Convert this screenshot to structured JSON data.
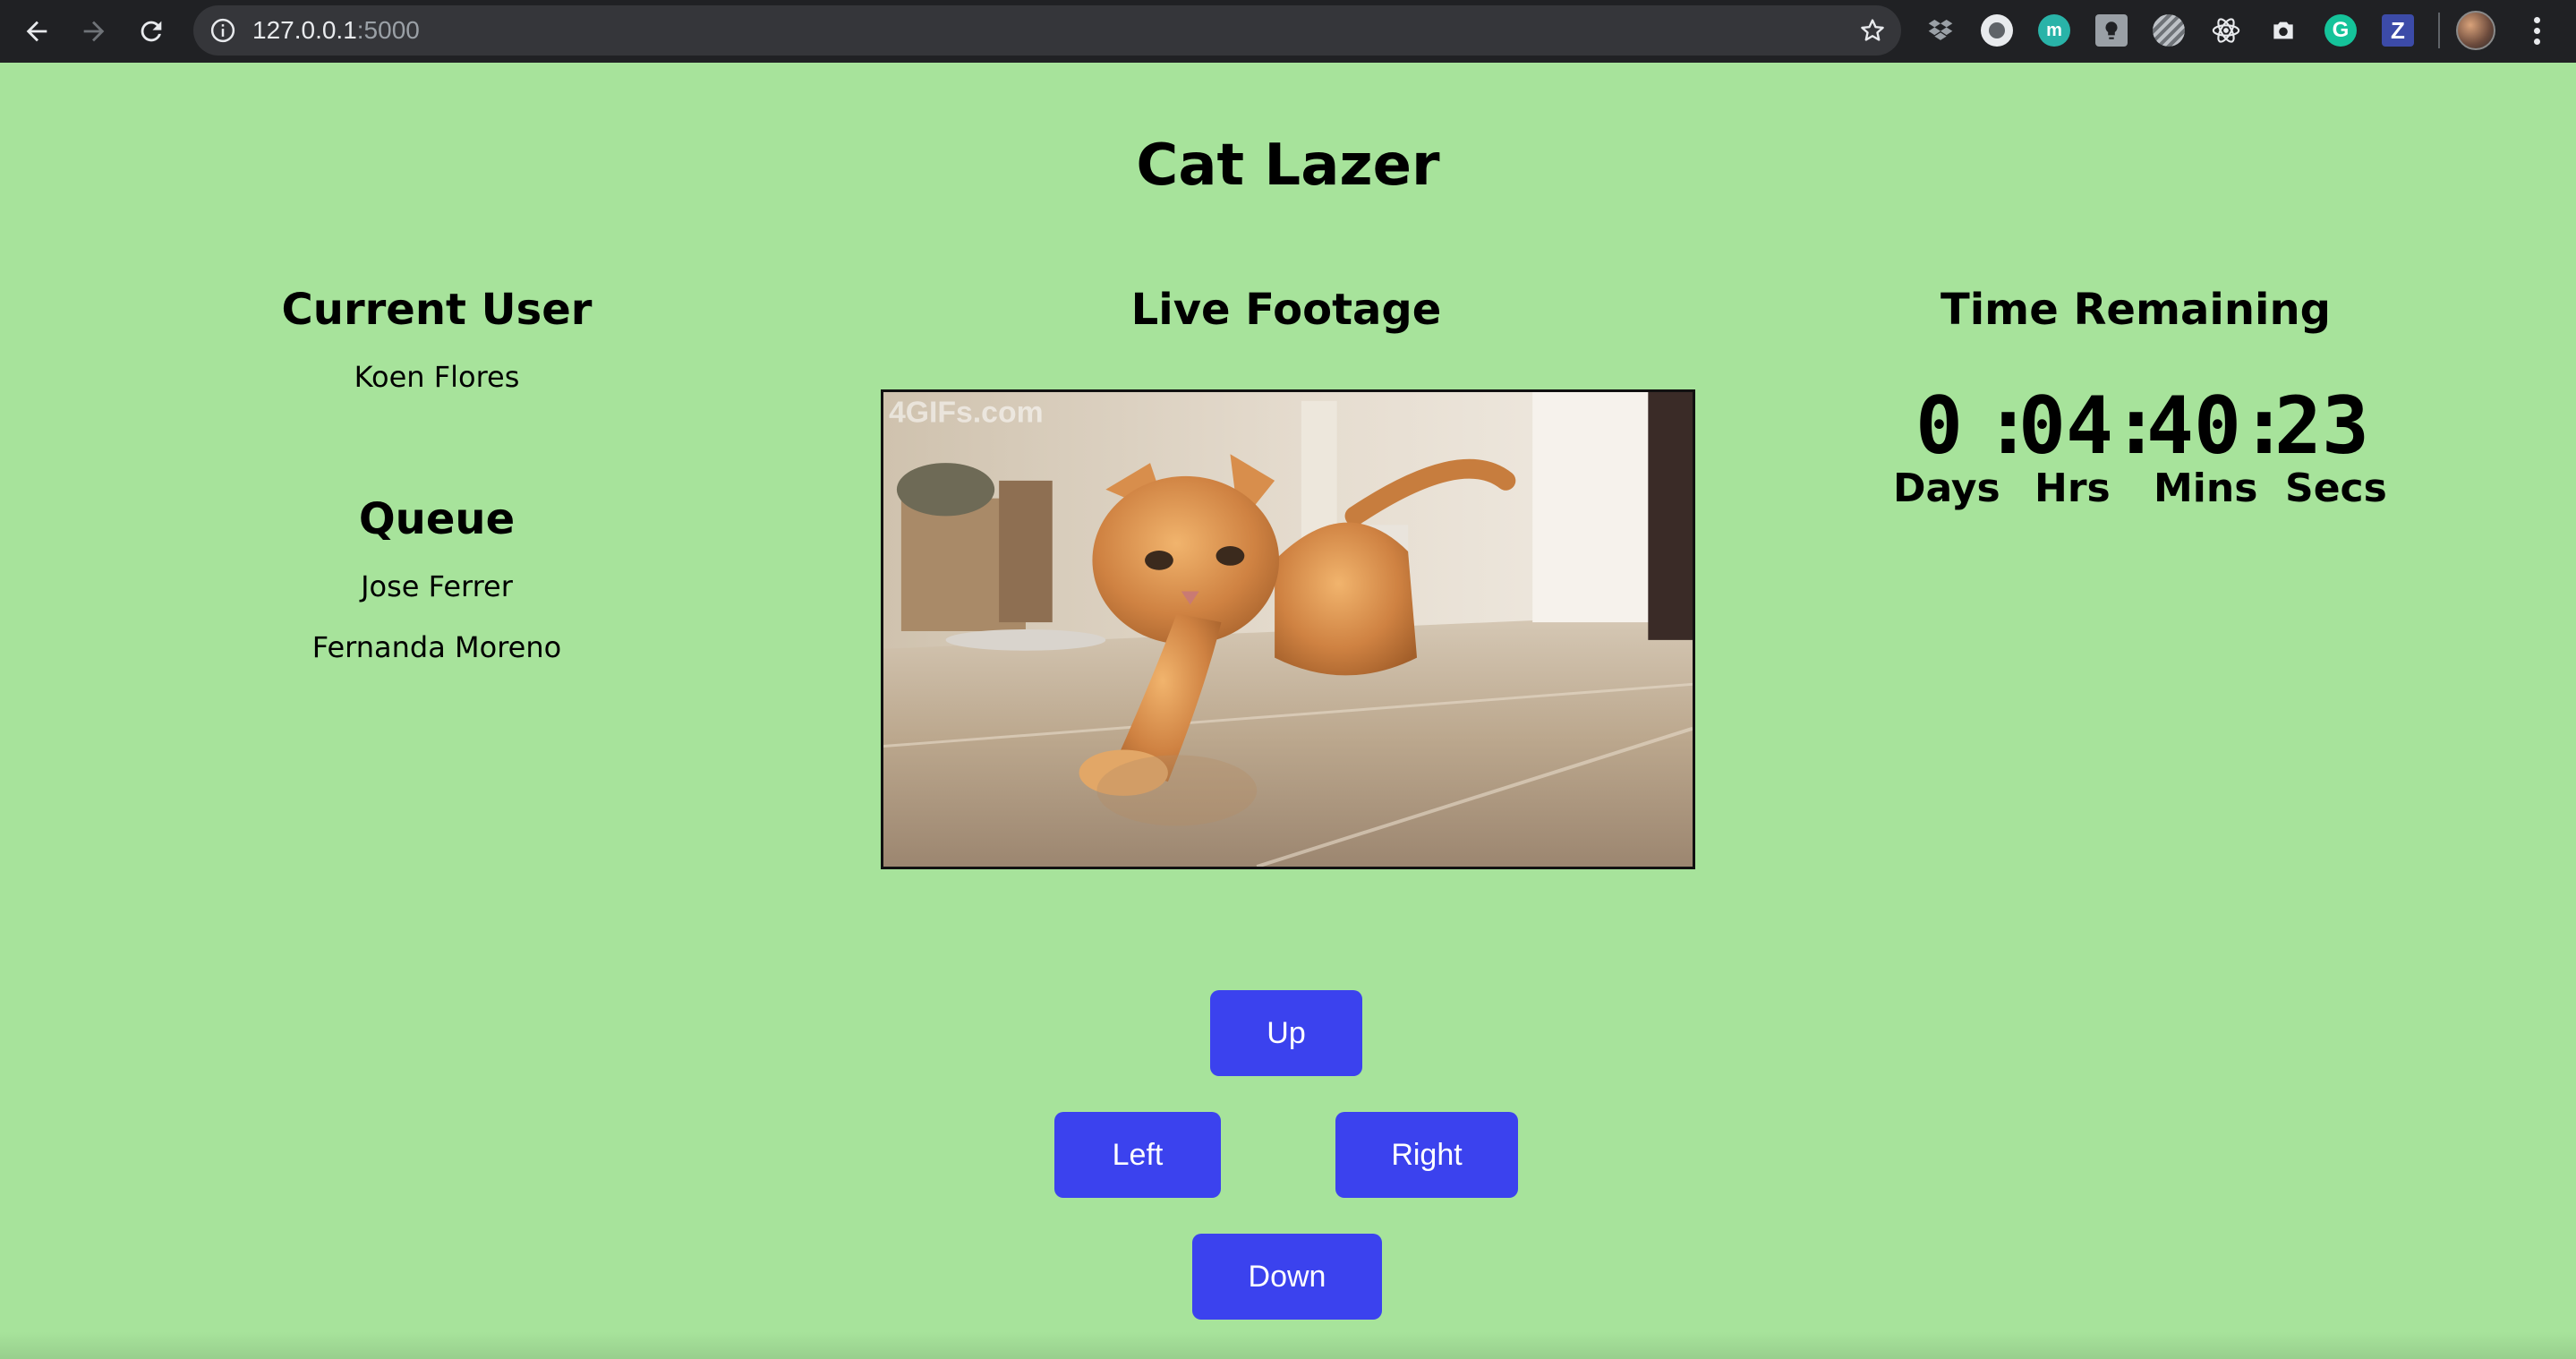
{
  "browser": {
    "url_host": "127.0.0.1",
    "url_port": ":5000"
  },
  "page": {
    "title": "Cat Lazer",
    "current_user": {
      "heading": "Current User",
      "name": "Koen Flores"
    },
    "queue": {
      "heading": "Queue",
      "items": [
        "Jose Ferrer",
        "Fernanda Moreno"
      ]
    },
    "live_footage": {
      "heading": "Live Footage",
      "watermark": "4GIFs.com"
    },
    "time_remaining": {
      "heading": "Time Remaining",
      "days": "0",
      "hrs": "04",
      "mins": "40",
      "secs": "23",
      "sep1": ":",
      "sep2": ":",
      "sep3": ":",
      "labels": {
        "days": "Days",
        "hrs": "Hrs",
        "mins": "Mins",
        "secs": "Secs"
      }
    },
    "controls": {
      "up": "Up",
      "left": "Left",
      "right": "Right",
      "down": "Down"
    }
  },
  "colors": {
    "page_background": "#a7e39b",
    "button": "#3b42ee",
    "browser_chrome": "#202124"
  },
  "extension_icons": [
    "dropbox-icon",
    "circle-record-icon",
    "teal-m-icon",
    "lightbulb-icon",
    "striped-circle-icon",
    "react-atom-icon",
    "camera-icon",
    "grammarly-icon",
    "z-icon"
  ]
}
